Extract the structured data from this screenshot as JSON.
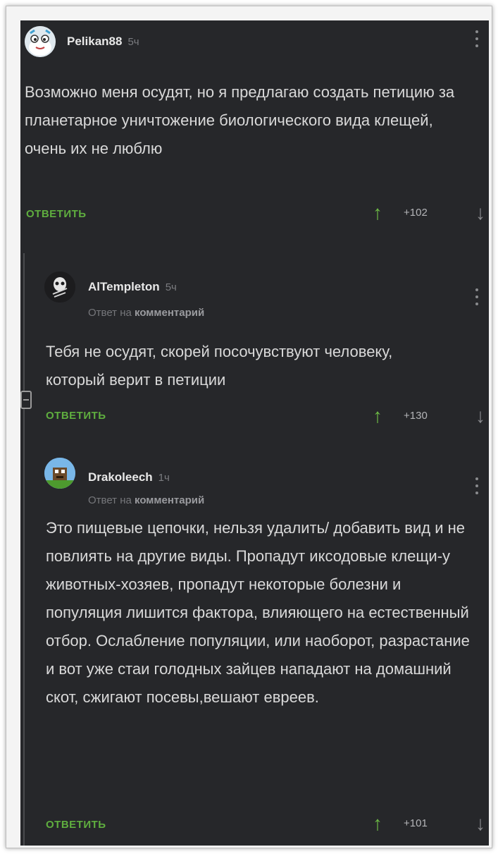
{
  "comments": [
    {
      "author": "Pelikan88",
      "time": "5ч",
      "text": "Возможно меня осудят, но я предлагаю создать петицию за планетарное уничтожение биологического вида клещей, очень их не люблю",
      "reply_label": "ОТВЕТИТЬ",
      "score": "+102"
    },
    {
      "author": "AlTempleton",
      "time": "5ч",
      "reply_prefix": "Ответ на",
      "reply_target": "комментарий",
      "text": "Тебя не осудят, скорей посочувствуют человеку, который верит в петиции",
      "reply_label": "ОТВЕТИТЬ",
      "score": "+130"
    },
    {
      "author": "Drakoleech",
      "time": "1ч",
      "reply_prefix": "Ответ на",
      "reply_target": "комментарий",
      "text": "Это пищевые цепочки, нельзя удалить/ добавить вид и не повлиять на другие виды. Пропадут иксодовые клещи-у животных-хозяев, пропадут некоторые болезни и популяция лишится фактора, влияющего на естественный отбор. Ослабление популяции, или наоборот, разрастание и вот уже стаи голодных зайцев нападают на домашний скот, сжигают посевы,вешают евреев.",
      "reply_label": "ОТВЕТИТЬ",
      "score": "+101"
    }
  ],
  "icons": {
    "upvote": "arrow-up-icon",
    "downvote": "arrow-down-icon",
    "menu": "more-vertical-icon",
    "collapse": "collapse-minus-icon"
  },
  "colors": {
    "background": "#26272a",
    "accent_green": "#5fae3f",
    "text": "#d9d9d9"
  }
}
